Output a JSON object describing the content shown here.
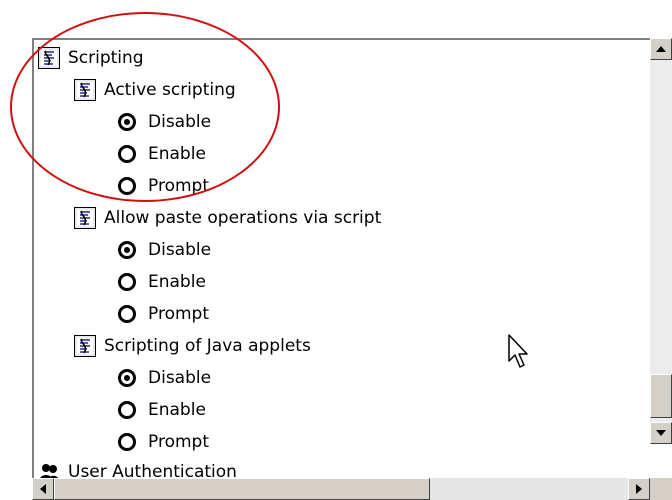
{
  "tree": {
    "category": "Scripting",
    "groups": [
      {
        "title": "Active scripting",
        "options": [
          {
            "label": "Disable",
            "selected": true
          },
          {
            "label": "Enable",
            "selected": false
          },
          {
            "label": "Prompt",
            "selected": false
          }
        ]
      },
      {
        "title": "Allow paste operations via script",
        "options": [
          {
            "label": "Disable",
            "selected": true
          },
          {
            "label": "Enable",
            "selected": false
          },
          {
            "label": "Prompt",
            "selected": false
          }
        ]
      },
      {
        "title": "Scripting of Java applets",
        "options": [
          {
            "label": "Disable",
            "selected": true
          },
          {
            "label": "Enable",
            "selected": false
          },
          {
            "label": "Prompt",
            "selected": false
          }
        ]
      }
    ],
    "next_category": "User Authentication"
  },
  "annotation": {
    "color": "#d01010"
  }
}
